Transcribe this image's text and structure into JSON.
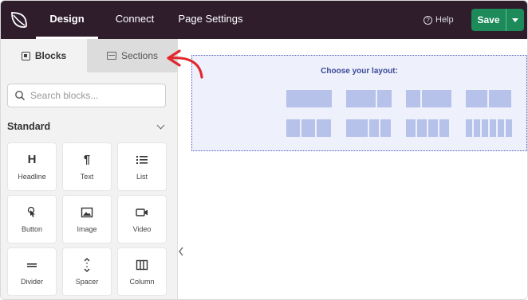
{
  "topbar": {
    "tabs": [
      {
        "label": "Design",
        "active": true
      },
      {
        "label": "Connect",
        "active": false
      },
      {
        "label": "Page Settings",
        "active": false
      }
    ],
    "help_label": "Help",
    "save_label": "Save",
    "colors": {
      "bar": "#2f1d2c",
      "save": "#1d8a5a"
    }
  },
  "sidebar": {
    "tabs": [
      {
        "label": "Blocks",
        "active": true
      },
      {
        "label": "Sections",
        "active": false
      }
    ],
    "search": {
      "placeholder": "Search blocks...",
      "value": ""
    },
    "group": {
      "title": "Standard",
      "blocks": [
        {
          "label": "Headline",
          "icon": "headline-icon"
        },
        {
          "label": "Text",
          "icon": "paragraph-icon"
        },
        {
          "label": "List",
          "icon": "list-icon"
        },
        {
          "label": "Button",
          "icon": "button-pointer-icon"
        },
        {
          "label": "Image",
          "icon": "image-icon"
        },
        {
          "label": "Video",
          "icon": "video-icon"
        },
        {
          "label": "Divider",
          "icon": "divider-icon"
        },
        {
          "label": "Spacer",
          "icon": "spacer-icon"
        },
        {
          "label": "Column",
          "icon": "column-icon"
        }
      ]
    }
  },
  "canvas": {
    "layout_title": "Choose your layout:",
    "layout_options": [
      {
        "columns": 1
      },
      {
        "columns": 2
      },
      {
        "columns": 2
      },
      {
        "columns": 2
      },
      {
        "columns": 3
      },
      {
        "columns": 3
      },
      {
        "columns": 4
      },
      {
        "columns": 6
      }
    ],
    "colors": {
      "box": "#eef0fb",
      "border": "#4a56b8",
      "option": "#b7c2ea"
    }
  },
  "annotation": {
    "type": "red-arrow",
    "points_to": "Sections",
    "color": "#e0282e"
  }
}
